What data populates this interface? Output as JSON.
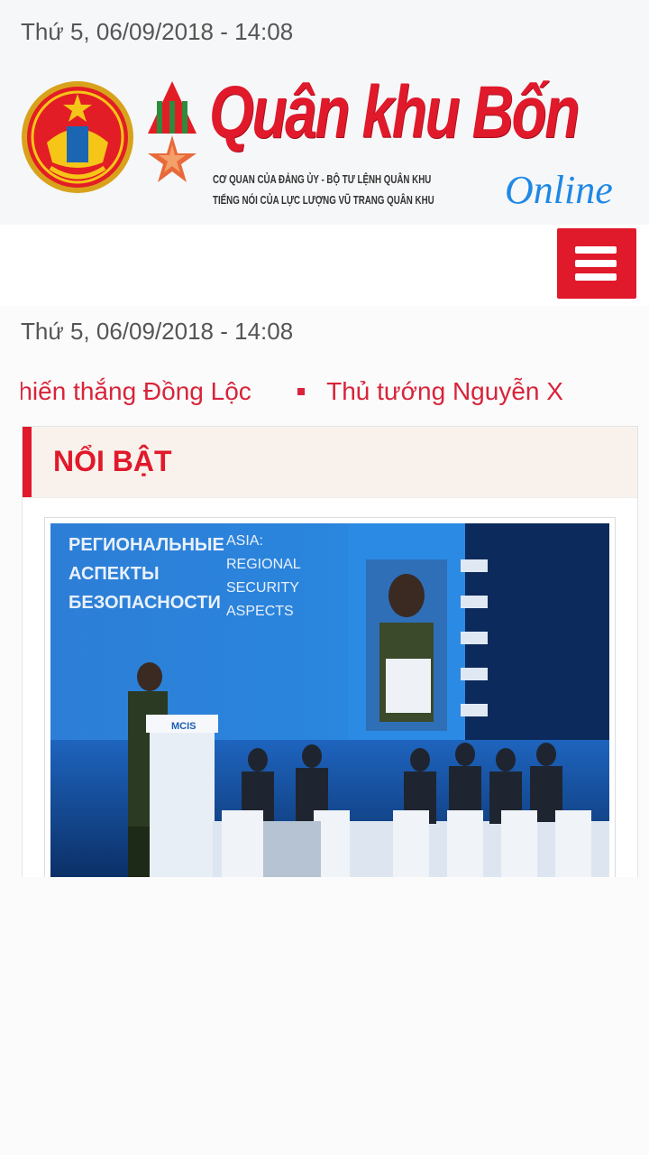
{
  "header": {
    "date": "Thứ 5, 06/09/2018 - 14:08",
    "logo": {
      "title": "Quân khu Bốn",
      "subtitle_line1": "CƠ QUAN CỦA ĐẢNG ỦY - BỘ TƯ LỆNH QUÂN KHU",
      "subtitle_line2": "TIẾNG NÓI CỦA LỰC LƯỢNG VŨ TRANG QUÂN KHU",
      "online": "Online"
    },
    "emblem_icon": "military-region-emblem-icon",
    "medal_icon": "medal-star-icon"
  },
  "nav": {
    "menu_icon": "hamburger-icon",
    "date": "Thứ 5, 06/09/2018 - 14:08"
  },
  "ticker": {
    "items": [
      "n chiến thắng Đồng Lộc",
      "Thủ tướng Nguyễn X"
    ]
  },
  "featured": {
    "title": "NỔI BẬT",
    "image_text": {
      "ru_line1": "РЕГИОНАЛЬНЫЕ",
      "ru_line2": "АСПЕКТЫ",
      "ru_line3": "БЕЗОПАСНОСТИ",
      "en_line1": "ASIA:",
      "en_line2": "REGIONAL",
      "en_line3": "SECURITY",
      "en_line4": "ASPECTS",
      "podium_logo": "MCIS"
    }
  },
  "colors": {
    "brand_red": "#e0192b",
    "ticker_red": "#d8243a",
    "online_blue": "#1e88e5",
    "header_bg": "#f6f7f9",
    "featured_header_bg": "#f9f2ec"
  }
}
